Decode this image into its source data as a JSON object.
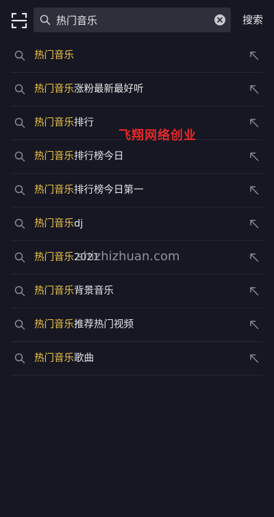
{
  "search": {
    "value": "热门音乐",
    "submit_label": "搜索"
  },
  "suggestions": [
    {
      "highlight": "热门音乐",
      "rest": ""
    },
    {
      "highlight": "热门音乐",
      "rest": "涨粉最新最好听"
    },
    {
      "highlight": "热门音乐",
      "rest": "排行"
    },
    {
      "highlight": "热门音乐",
      "rest": "排行榜今日"
    },
    {
      "highlight": "热门音乐",
      "rest": "排行榜今日第一"
    },
    {
      "highlight": "热门音乐",
      "rest": "dj"
    },
    {
      "highlight": "热门音乐",
      "rest": "2021"
    },
    {
      "highlight": "热门音乐",
      "rest": "背景音乐"
    },
    {
      "highlight": "热门音乐",
      "rest": "推荐热门视频"
    },
    {
      "highlight": "热门音乐",
      "rest": "歌曲"
    }
  ],
  "watermarks": {
    "brand": "飞翔网络创业",
    "site": "shizhizhuan.com"
  },
  "colors": {
    "background": "#161722",
    "highlight": "#f0c54a",
    "watermark_brand": "#e8282b"
  }
}
